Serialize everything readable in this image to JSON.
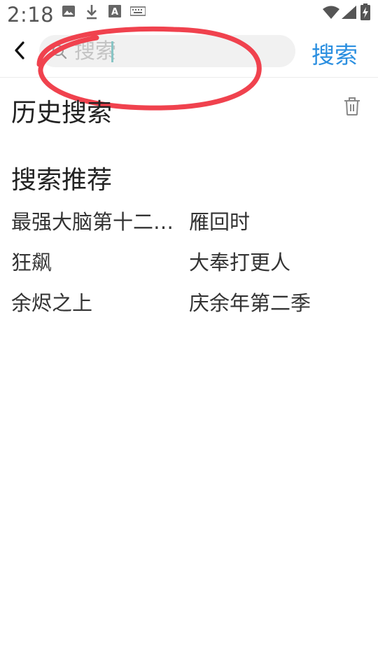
{
  "status_bar": {
    "time": "2:18",
    "icons": [
      "image-icon",
      "download-icon",
      "font-icon",
      "keyboard-icon",
      "wifi-icon",
      "signal-icon",
      "battery-charging-icon"
    ]
  },
  "header": {
    "back_icon": "chevron-left-icon",
    "search": {
      "placeholder": "搜索",
      "value": "",
      "icon": "search-icon"
    },
    "search_button_label": "搜索"
  },
  "history": {
    "title": "历史搜索",
    "clear_icon": "trash-icon"
  },
  "recommend": {
    "title": "搜索推荐",
    "items": [
      "最强大脑第十二…",
      "雁回时",
      "狂飙",
      "大奉打更人",
      "余烬之上",
      "庆余年第二季"
    ]
  },
  "colors": {
    "accent": "#2b8fe0",
    "annotation": "#f0424e",
    "search_bg": "#f1f1f1"
  }
}
